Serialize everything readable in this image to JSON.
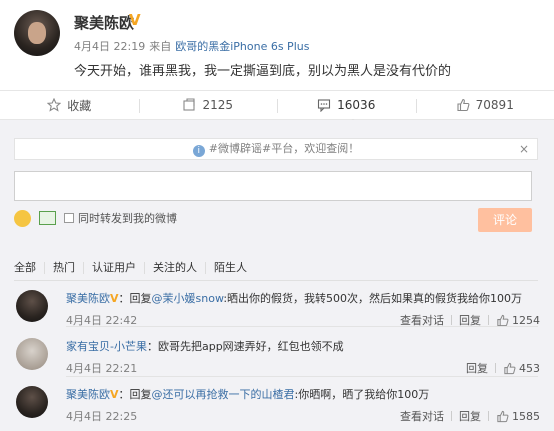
{
  "post": {
    "author": "聚美陈欧",
    "date": "4月4日 22:19",
    "via": "来自",
    "device": "欧哥的黑金iPhone 6s Plus",
    "text": "今天开始，谁再黑我，我一定撕逼到底，别以为黑人是没有代价的"
  },
  "actions": {
    "favorite": "收藏",
    "repost": "2125",
    "comment": "16036",
    "like": "70891"
  },
  "notice": {
    "text": "#微博辟谣#平台，欢迎查阅！",
    "close": "×"
  },
  "compose": {
    "share_label": "同时转发到我的微博",
    "submit_label": "评论"
  },
  "filters": [
    "全部",
    "热门",
    "认证用户",
    "关注的人",
    "陌生人"
  ],
  "comments": [
    {
      "user": "聚美陈欧",
      "verified": true,
      "text_prefix": "：回复",
      "mention": "@茉小媛snow",
      "text": ":晒出你的假货，我转500次，然后如果真的假货我给你100万",
      "time": "4月4日 22:42",
      "view_dialog": "查看对话",
      "reply": "回复",
      "likes": "1254"
    },
    {
      "user": "家有宝贝-小芒果",
      "verified": false,
      "text_prefix": "：",
      "mention": "",
      "text": "欧哥先把app网速弄好，红包也领不成",
      "time": "4月4日 22:21",
      "view_dialog": "",
      "reply": "回复",
      "likes": "453"
    },
    {
      "user": "聚美陈欧",
      "verified": true,
      "text_prefix": "：回复",
      "mention": "@还可以再抢救一下的山楂君",
      "text": ":你晒啊，晒了我给你100万",
      "time": "4月4日 22:25",
      "view_dialog": "查看对话",
      "reply": "回复",
      "likes": "1585"
    }
  ],
  "verified_mark": "V",
  "colors": {
    "link": "#3a6ea5",
    "verified": "#f5a623",
    "submit_disabled": "#ffc09f",
    "background": "#f2f2f5"
  }
}
